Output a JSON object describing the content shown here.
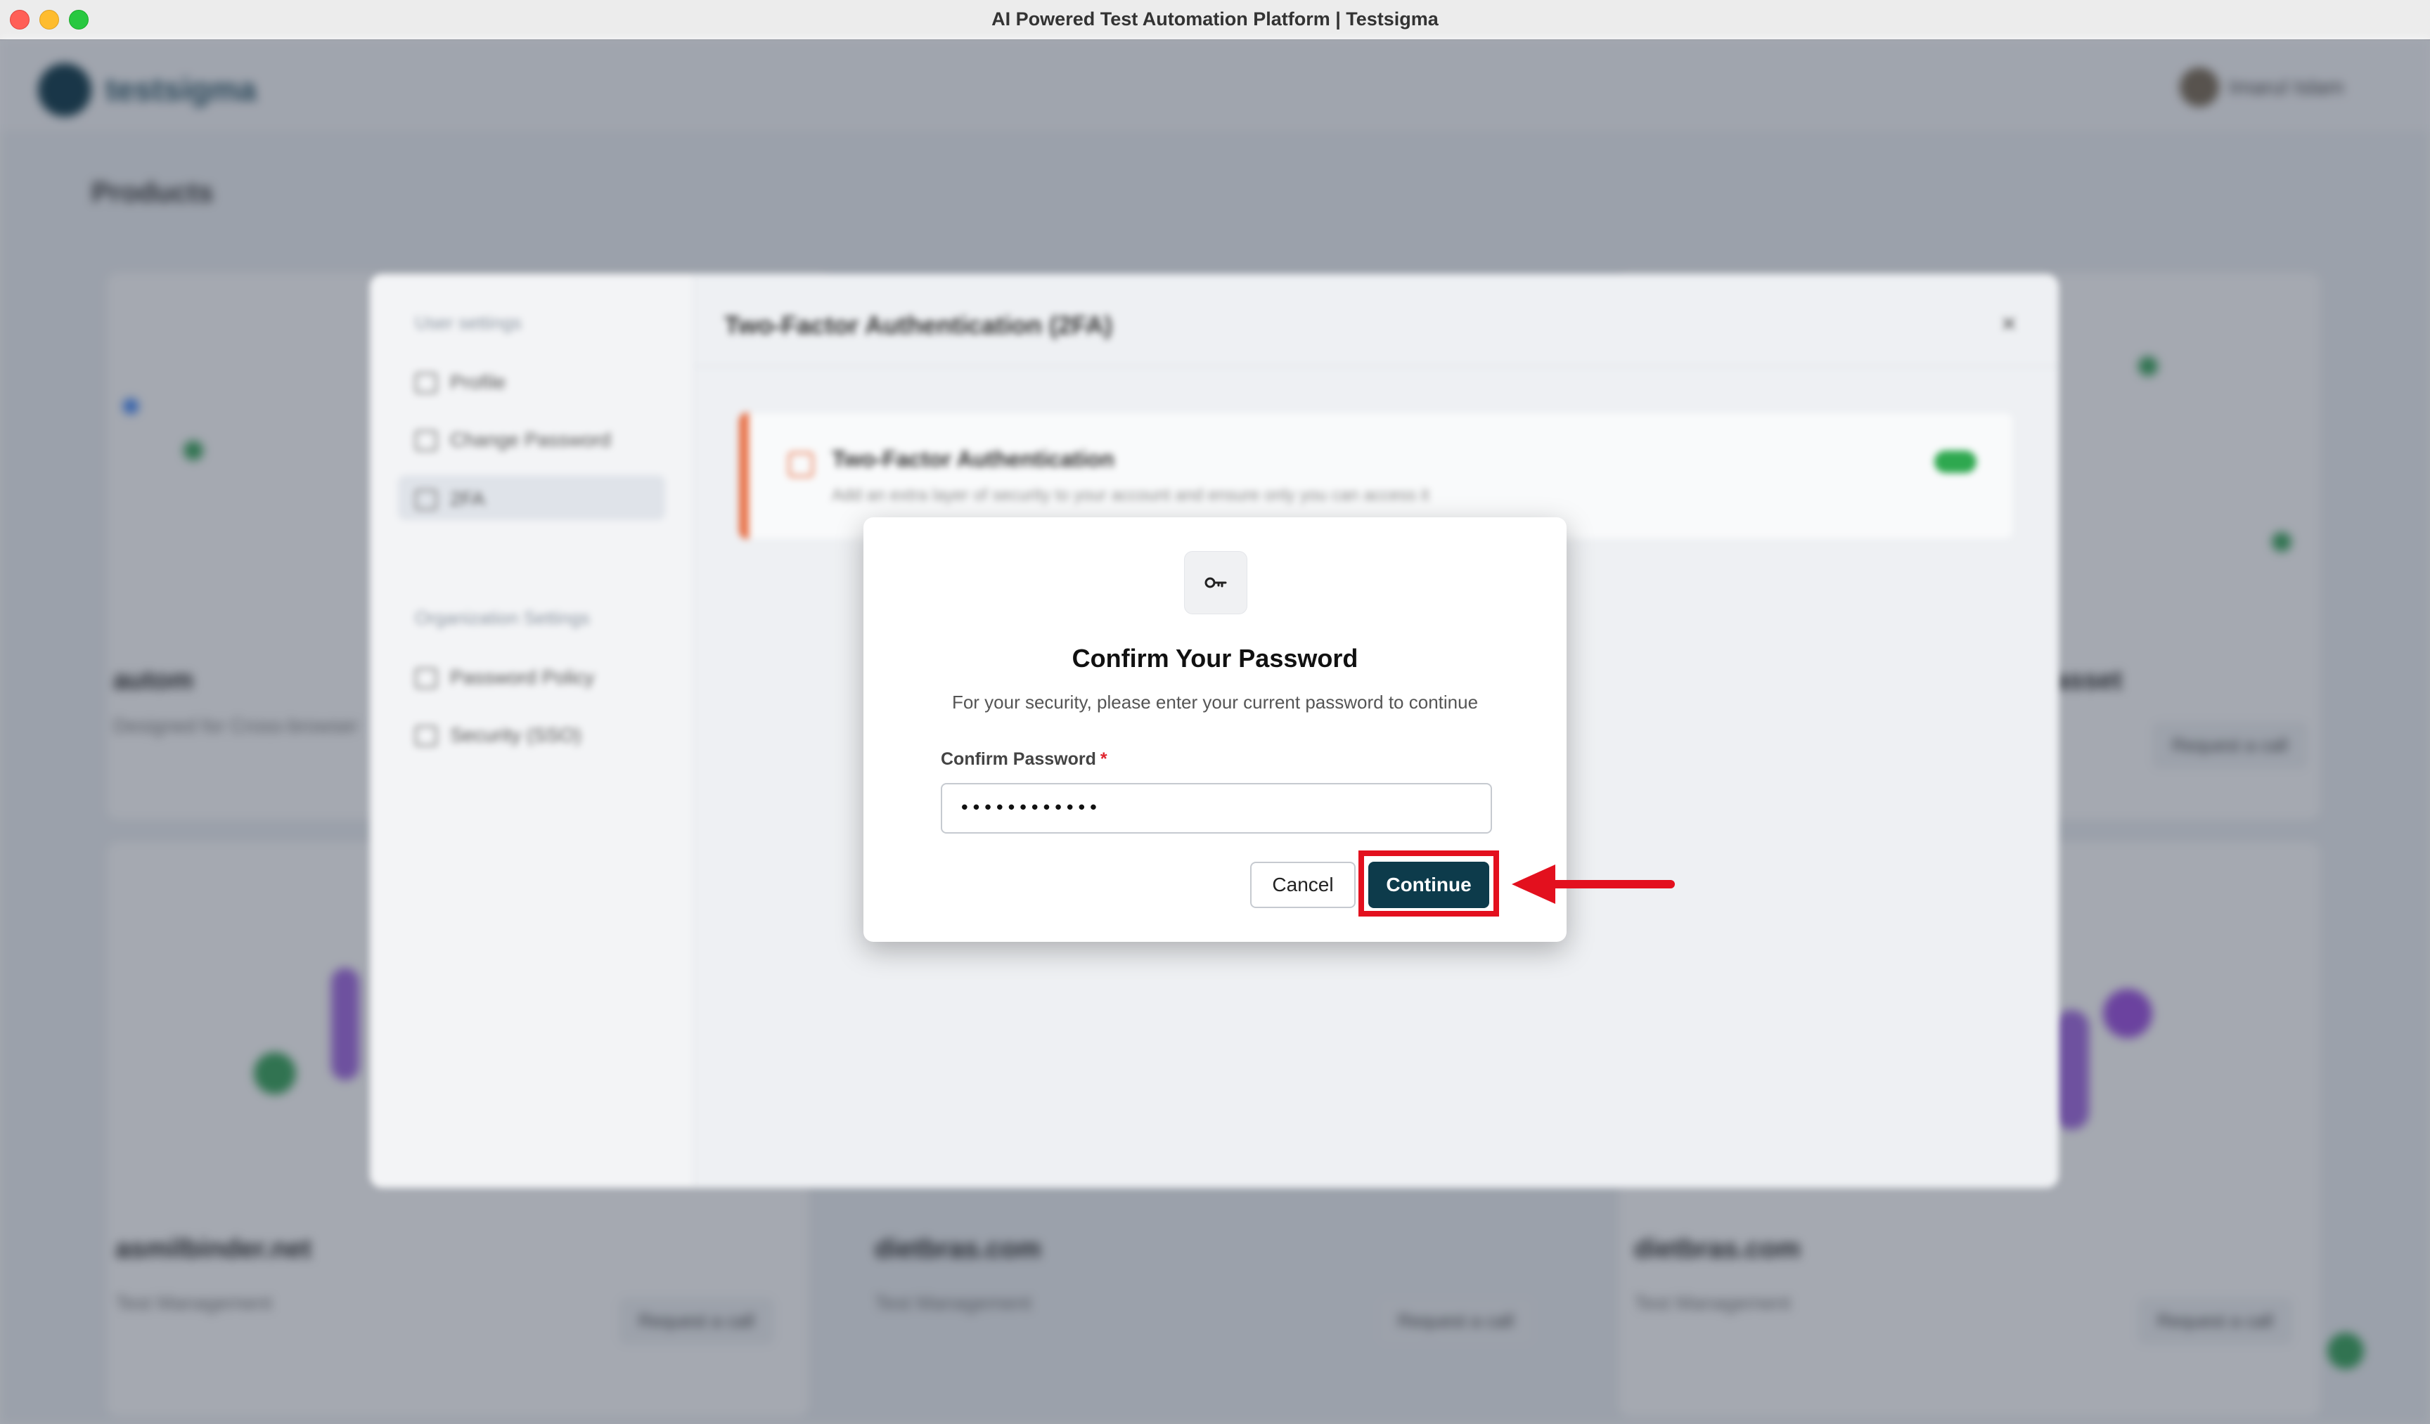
{
  "window": {
    "title": "AI Powered Test Automation Platform | Testsigma"
  },
  "background_app": {
    "logo_text": "testsigma",
    "user_name": "Imarul Islam",
    "products_heading": "Products",
    "cards": [
      {
        "title": "autom",
        "subtitle": "Designed for Cross-browser"
      },
      {
        "title": "asset",
        "subtitle": ""
      },
      {
        "title": "asmilbinder.net",
        "subtitle": "Test Management",
        "button": "Request a call"
      },
      {
        "title": "dietbras.com",
        "subtitle": "Test Management",
        "button": "Request a call"
      },
      {
        "title": "dietbras.com",
        "subtitle": "Test Management",
        "button": "Request a call"
      }
    ],
    "request_call_label": "Request a call"
  },
  "settings_dialog": {
    "user_settings_heading": "User settings",
    "nav_items": [
      "Profile",
      "Change Password",
      "2FA"
    ],
    "org_settings_heading": "Organization Settings",
    "org_items": [
      "Password Policy",
      "Security (SSO)"
    ],
    "main_title": "Two-Factor Authentication (2FA)",
    "close_symbol": "×",
    "tfa_card_title": "Two-Factor Authentication",
    "tfa_card_desc": "Add an extra layer of security to your account and ensure only you can access it",
    "tfa_enabled": true
  },
  "modal": {
    "icon": "key-icon",
    "title": "Confirm Your Password",
    "description": "For your security, please enter your current password to continue",
    "field_label": "Confirm Password",
    "required_marker": "*",
    "password_value": "••••••••••••",
    "cancel_label": "Cancel",
    "continue_label": "Continue"
  },
  "annotation": {
    "highlight_color": "#e3101e",
    "target": "continue-button"
  },
  "colors": {
    "primary_button": "#0d3b4b",
    "accent_orange": "#e8734a",
    "toggle_green": "#2ea84f"
  }
}
